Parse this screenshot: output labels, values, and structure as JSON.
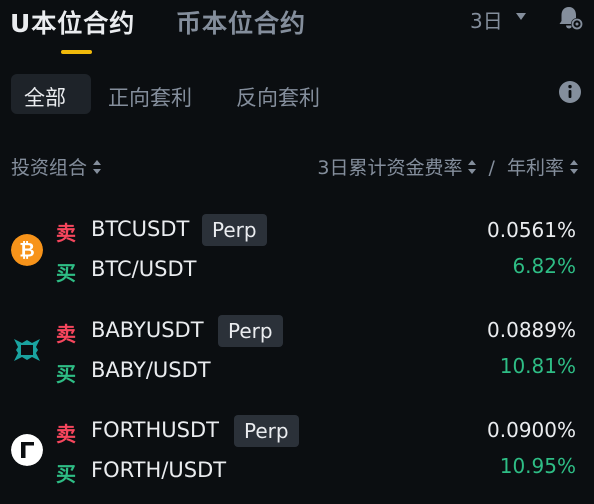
{
  "header": {
    "tab_active": "U本位合约",
    "tab_inactive": "币本位合约",
    "period": "3日"
  },
  "filters": [
    "全部",
    "正向套利",
    "反向套利"
  ],
  "columns": {
    "left": "投资组合",
    "right": "3日累计资金费率",
    "right_sep": "/",
    "right2": "年利率"
  },
  "colors": {
    "accent": "#f0b90b",
    "sell": "#f6465d",
    "buy": "#2ebd85",
    "background": "#0b0e11"
  },
  "rows": [
    {
      "icon": "bitcoin-icon",
      "sell_label": "卖",
      "buy_label": "买",
      "perp_symbol": "BTCUSDT",
      "perp_tag": "Perp",
      "spot_symbol": "BTC/USDT",
      "funding_rate": "0.0561%",
      "apr": "6.82%"
    },
    {
      "icon": "baby-icon",
      "sell_label": "卖",
      "buy_label": "买",
      "perp_symbol": "BABYUSDT",
      "perp_tag": "Perp",
      "spot_symbol": "BABY/USDT",
      "funding_rate": "0.0889%",
      "apr": "10.81%"
    },
    {
      "icon": "forth-icon",
      "sell_label": "卖",
      "buy_label": "买",
      "perp_symbol": "FORTHUSDT",
      "perp_tag": "Perp",
      "spot_symbol": "FORTH/USDT",
      "funding_rate": "0.0900%",
      "apr": "10.95%"
    }
  ]
}
